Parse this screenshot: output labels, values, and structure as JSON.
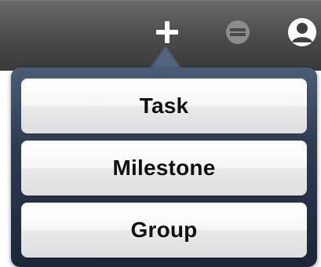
{
  "toolbar": {
    "buttons": [
      {
        "icon": "plus-icon"
      },
      {
        "icon": "collapse-icon"
      },
      {
        "icon": "user-icon"
      }
    ]
  },
  "popover": {
    "items": [
      {
        "label": "Task"
      },
      {
        "label": "Milestone"
      },
      {
        "label": "Group"
      }
    ]
  },
  "colors": {
    "toolbar_bg": "#4a4a4a",
    "popover_bg": "#2d3b52",
    "item_bg": "#f2f2f2",
    "item_text": "#111111"
  }
}
